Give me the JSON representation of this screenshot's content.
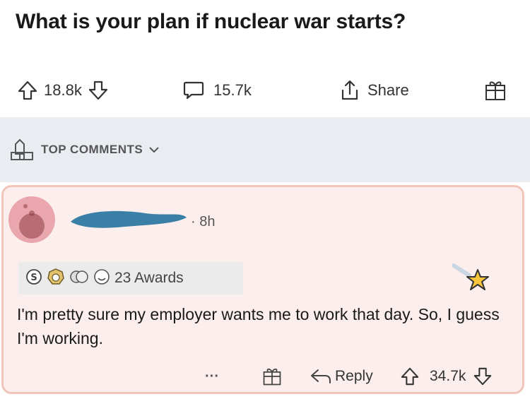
{
  "post": {
    "title": "What is your plan if nuclear war starts?",
    "upvotes": "18.8k",
    "comments": "15.7k",
    "share_label": "Share",
    "icons": [
      "upvote-icon",
      "downvote-icon",
      "comment-icon",
      "share-icon",
      "gift-icon"
    ]
  },
  "section": {
    "sort_label": "TOP COMMENTS"
  },
  "comment": {
    "time": "· 8h",
    "awards_label": "23 Awards",
    "text": "I'm pretty sure my employer wants me to work that day. So, I guess I'm working.",
    "more_label": "···",
    "reply_label": "Reply",
    "score": "34.7k"
  },
  "colors": {
    "card_background": "#fbeeec",
    "card_border": "#f2c4ba",
    "section_background": "#e9ecf0",
    "avatar_background": "#e9a6ad",
    "redaction": "#3a7fa6"
  }
}
